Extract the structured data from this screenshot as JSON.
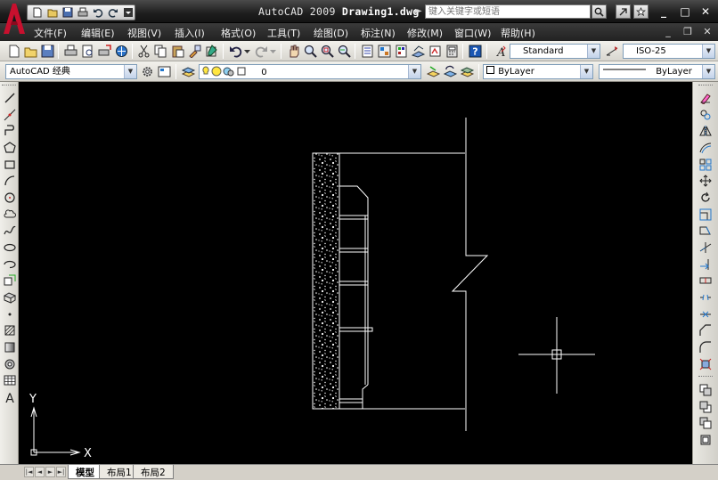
{
  "window": {
    "title_app": "AutoCAD 2009",
    "title_file": "Drawing1.dwg",
    "search_placeholder": "键入关键字或短语",
    "controls": {
      "minimize": "_",
      "maximize": "□",
      "close": "✕"
    }
  },
  "menu": [
    "文件(F)",
    "编辑(E)",
    "视图(V)",
    "插入(I)",
    "格式(O)",
    "工具(T)",
    "绘图(D)",
    "标注(N)",
    "修改(M)",
    "窗口(W)",
    "帮助(H)"
  ],
  "toolbar1": {
    "text_style": "Standard",
    "dim_style": "ISO-25"
  },
  "toolbar2": {
    "workspace": "AutoCAD 经典",
    "layer": "0",
    "color": "ByLayer",
    "linetype": "ByLayer"
  },
  "canvas": {
    "background": "#000000",
    "line_color": "#ffffff",
    "ucs_x_label": "X",
    "ucs_y_label": "Y"
  },
  "layout_tabs": [
    {
      "label": "模型",
      "active": true
    },
    {
      "label": "布局1",
      "active": false
    },
    {
      "label": "布局2",
      "active": false
    }
  ],
  "colors": {
    "titlebar": "#1e1e1e",
    "logo_red": "#c8102e",
    "toolbar": "#e4e2dc"
  }
}
